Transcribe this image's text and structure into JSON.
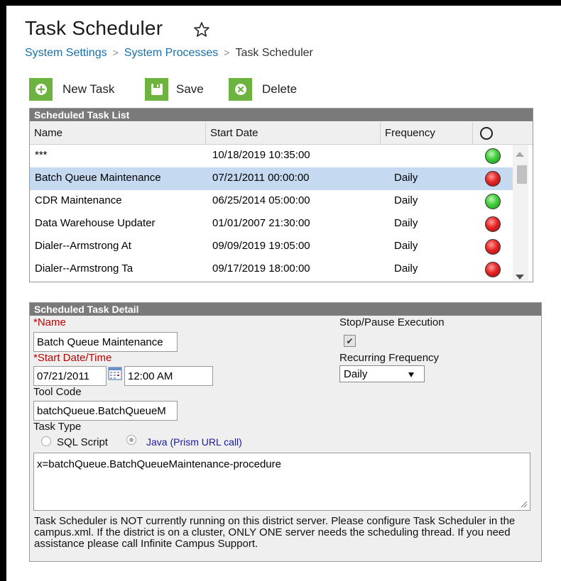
{
  "page": {
    "title": "Task Scheduler",
    "breadcrumb": [
      "System Settings",
      "System Processes",
      "Task Scheduler"
    ]
  },
  "toolbar": {
    "new_label": "New Task",
    "save_label": "Save",
    "delete_label": "Delete"
  },
  "task_list": {
    "title": "Scheduled Task List",
    "columns": [
      "Name",
      "Start Date",
      "Frequency"
    ],
    "rows": [
      {
        "name": "***",
        "start": "10/18/2019 10:35:00",
        "frequency": "",
        "status": "green"
      },
      {
        "name": "Batch Queue Maintenance",
        "start": "07/21/2011 00:00:00",
        "frequency": "Daily",
        "status": "red",
        "selected": true
      },
      {
        "name": "CDR Maintenance",
        "start": "06/25/2014 05:00:00",
        "frequency": "Daily",
        "status": "green"
      },
      {
        "name": "Data Warehouse Updater",
        "start": "01/01/2007 21:30:00",
        "frequency": "Daily",
        "status": "red"
      },
      {
        "name": "Dialer--Armstrong At",
        "start": "09/09/2019 19:05:00",
        "frequency": "Daily",
        "status": "red"
      },
      {
        "name": "Dialer--Armstrong Ta",
        "start": "09/17/2019 18:00:00",
        "frequency": "Daily",
        "status": "red"
      }
    ]
  },
  "detail": {
    "title": "Scheduled Task Detail",
    "name_label": "*Name",
    "name_value": "Batch Queue Maintenance",
    "start_label": "*Start Date/Time",
    "start_date": "07/21/2011",
    "start_time": "12:00 AM",
    "tool_code_label": "Tool Code",
    "tool_code_value": "batchQueue.BatchQueueM",
    "task_type_label": "Task Type",
    "task_type_options": [
      "SQL Script",
      "Java (Prism URL call)"
    ],
    "task_type_selected": "Java (Prism URL call)",
    "stop_label": "Stop/Pause Execution",
    "stop_checked": true,
    "recurring_label": "Recurring Frequency",
    "recurring_value": "Daily",
    "script_value": "x=batchQueue.BatchQueueMaintenance-procedure",
    "warning": "Task Scheduler is NOT currently running on this district server. Please configure Task Scheduler in the campus.xml. If the district is on a cluster, ONLY ONE server needs the scheduling thread. If you need assistance please call Infinite Campus Support."
  },
  "colors": {
    "accent_green": "#6cb33f",
    "link_blue": "#1a6fa8",
    "required_red": "#c00000",
    "selected_row": "#c5daf0",
    "panel_header": "#7a7a7a"
  }
}
